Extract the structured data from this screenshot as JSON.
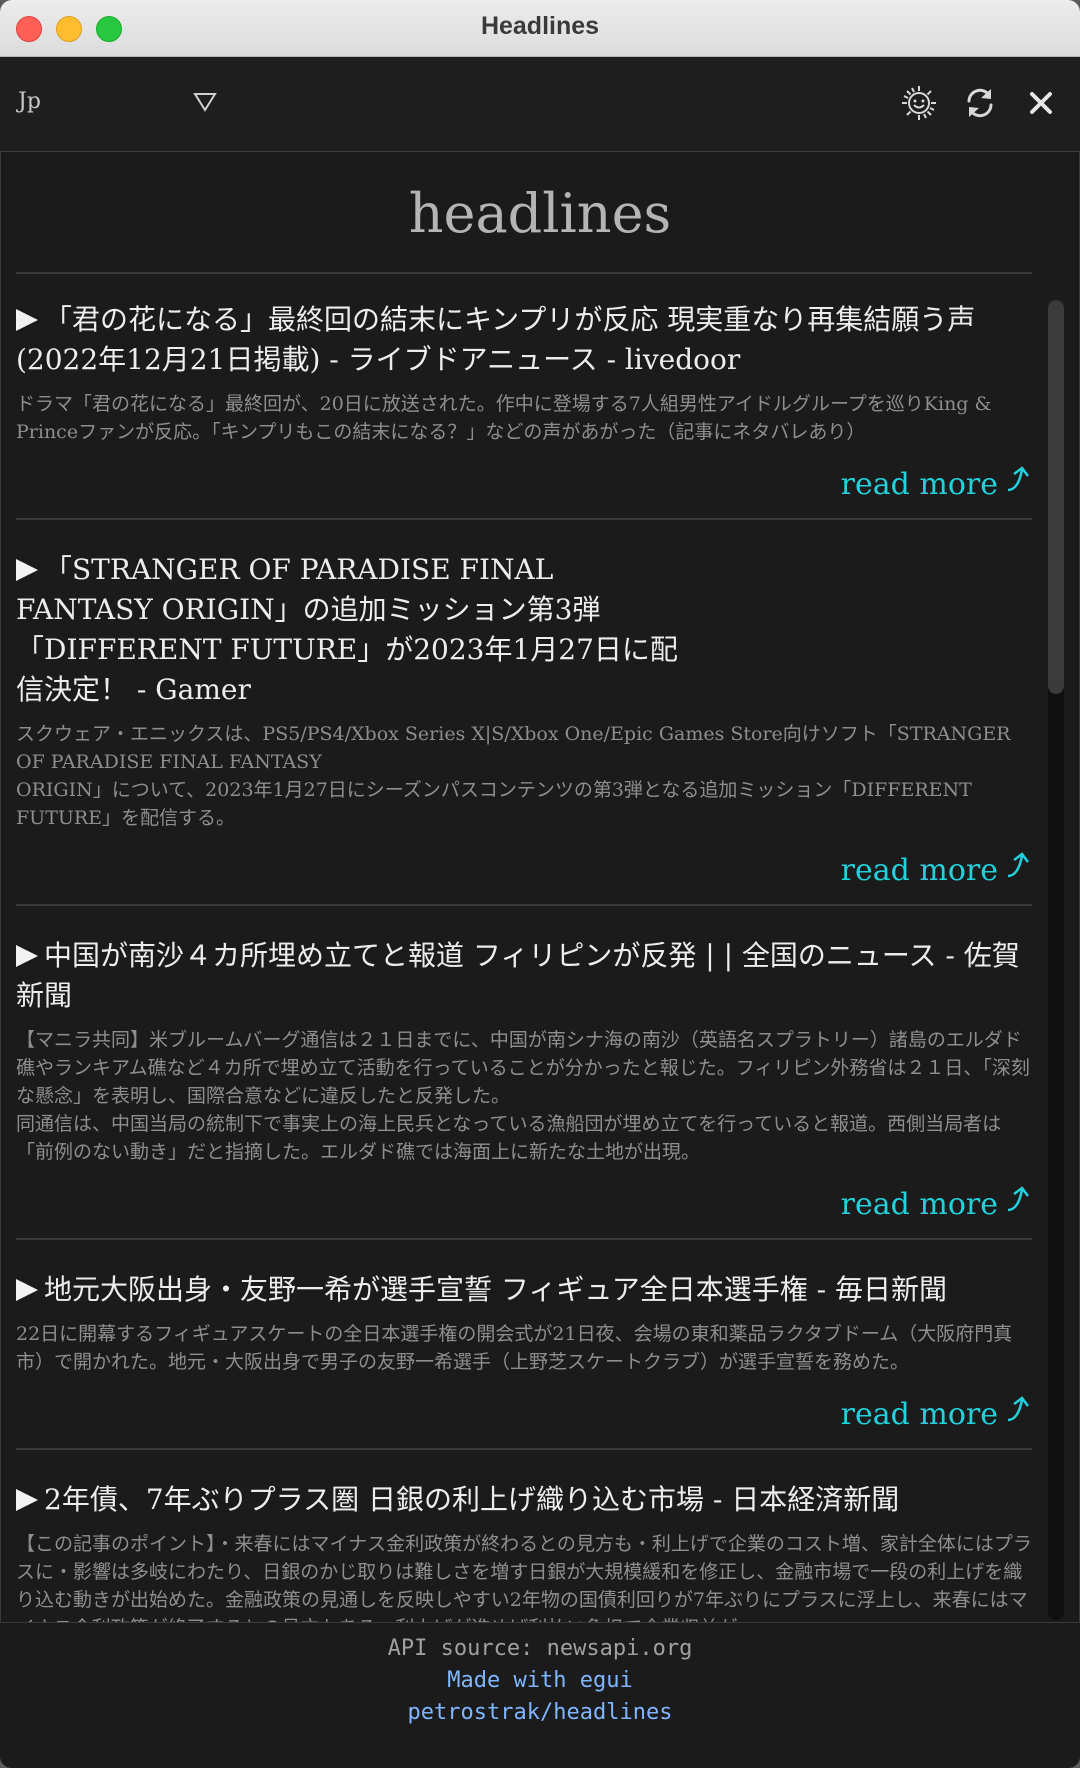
{
  "window": {
    "title": "Headlines"
  },
  "toolbar": {
    "country_selected": "Jp",
    "icons": {
      "theme": "sun-icon",
      "refresh": "refresh-icon",
      "close": "close-icon"
    }
  },
  "heading": "headlines",
  "read_more_label": "read more",
  "articles": [
    {
      "title": "「君の花になる」最終回の結末にキンプリが反応 現実重なり再集結願う声(2022年12月21日掲載) - ライブドアニュース - livedoor",
      "description": "ドラマ「君の花になる」最終回が、20日に放送された。作中に登場する7人組男性アイドルグループを巡りKing & Princeファンが反応。「キンプリもこの結末になる？」などの声があがった（記事にネタバレあり）"
    },
    {
      "title": "「STRANGER OF PARADISE FINAL FANTASY ORIGIN」の追加ミッション第3弾「DIFFERENT FUTURE」が2023年1月27日に配信決定！ - Gamer",
      "description": "スクウェア・エニックスは、PS5/PS4/Xbox Series X|S/Xbox One/Epic Games Store向けソフト「STRANGER OF PARADISE FINAL FANTASY\nORIGIN」について、2023年1月27日にシーズンパスコンテンツの第3弾となる追加ミッション「DIFFERENT FUTURE」を配信する。"
    },
    {
      "title": "中国が南沙４カ所埋め立てと報道 フィリピンが反発 | | 全国のニュース - 佐賀新聞",
      "description": "【マニラ共同】米ブルームバーグ通信は２１日までに、中国が南シナ海の南沙（英語名スプラトリー）諸島のエルダド礁やランキアム礁など４カ所で埋め立て活動を行っていることが分かったと報じた。フィリピン外務省は２１日、「深刻な懸念」を表明し、国際合意などに違反したと反発した。\n同通信は、中国当局の統制下で事実上の海上民兵となっている漁船団が埋め立てを行っていると報道。西側当局者は「前例のない動き」だと指摘した。エルダド礁では海面上に新たな土地が出現。"
    },
    {
      "title": "地元大阪出身・友野一希が選手宣誓 フィギュア全日本選手権 - 毎日新聞",
      "description": "22日に開幕するフィギュアスケートの全日本選手権の開会式が21日夜、会場の東和薬品ラクタブドーム（大阪府門真市）で開かれた。地元・大阪出身で男子の友野一希選手（上野芝スケートクラブ）が選手宣誓を務めた。"
    },
    {
      "title": "2年債、7年ぶりプラス圏 日銀の利上げ織り込む市場 - 日本経済新聞",
      "description": "【この記事のポイント】・来春にはマイナス金利政策が終わるとの見方も・利上げで企業のコスト増、家計全体にはプラスに・影響は多岐にわたり、日銀のかじ取りは難しさを増す日銀が大規模緩和を修正し、金融市場で一段の利上げを織り込む動きが出始めた。金融政策の見通しを反映しやすい2年物の国債利回りが7年ぶりにプラスに浮上し、来春にはマイナス金利政策が終了するとの見方もある。利上げが進めば利払い負担で企業収益が"
    }
  ],
  "footer": {
    "api_source": "API source: newsapi.org",
    "made_with": "Made with egui",
    "repo": "petrostrak/headlines"
  },
  "colors": {
    "background": "#1b1b1b",
    "accent_cyan": "#23d1dc",
    "link_blue": "#7fb6ff"
  }
}
